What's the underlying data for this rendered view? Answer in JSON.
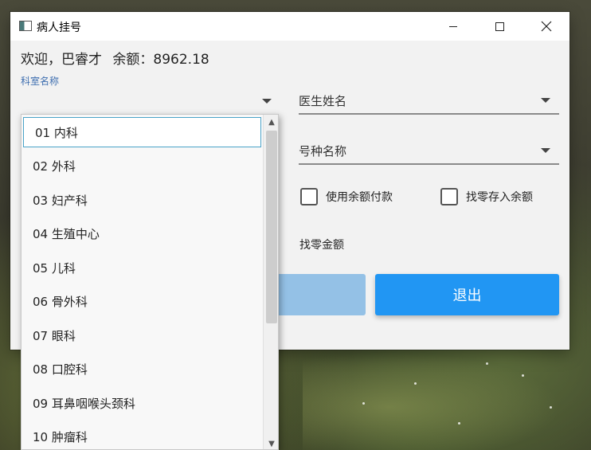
{
  "window": {
    "title": "病人挂号"
  },
  "welcome": {
    "greeting": "欢迎，巴睿才",
    "balance": "余额：8962.18"
  },
  "form": {
    "dept_label": "科室名称",
    "doctor_placeholder": "医生姓名",
    "type_placeholder": "号种名称",
    "use_balance_label": "使用余额付款",
    "save_change_label": "找零存入余额",
    "change_amount_label": "找零金额",
    "exit_label": "退出"
  },
  "dept_dropdown": {
    "options": [
      "01 内科",
      "02 外科",
      "03 妇产科",
      "04 生殖中心",
      "05 儿科",
      "06 骨外科",
      "07 眼科",
      "08 口腔科",
      "09 耳鼻咽喉头颈科",
      "10 肿瘤科"
    ],
    "selected_index": 0
  },
  "colors": {
    "accent": "#2196f3",
    "accent_disabled": "#94c1e6",
    "label_blue": "#3f6fb0"
  }
}
